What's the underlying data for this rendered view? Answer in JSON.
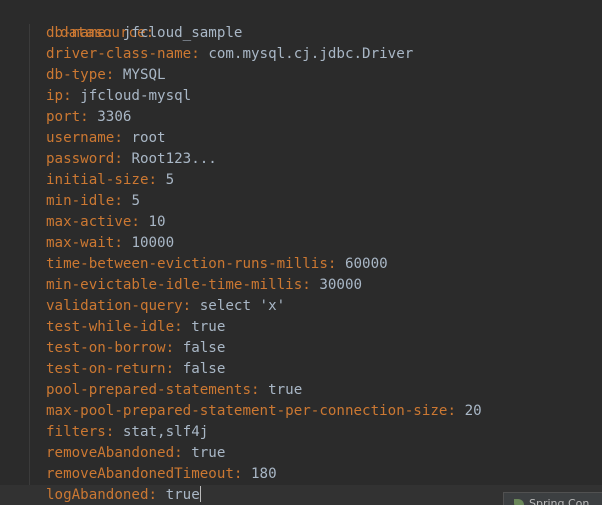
{
  "colors": {
    "background": "#2b2b2b",
    "key": "#cc7832",
    "value": "#a9b7c6"
  },
  "yaml": {
    "root_key": "datasource",
    "entries": [
      {
        "key": "db-name",
        "value": "jfcloud_sample"
      },
      {
        "key": "driver-class-name",
        "value": "com.mysql.cj.jdbc.Driver"
      },
      {
        "key": "db-type",
        "value": "MYSQL"
      },
      {
        "key": "ip",
        "value": "jfcloud-mysql"
      },
      {
        "key": "port",
        "value": "3306"
      },
      {
        "key": "username",
        "value": "root"
      },
      {
        "key": "password",
        "value": "Root123..."
      },
      {
        "key": "initial-size",
        "value": "5"
      },
      {
        "key": "min-idle",
        "value": "5"
      },
      {
        "key": "max-active",
        "value": "10"
      },
      {
        "key": "max-wait",
        "value": "10000"
      },
      {
        "key": "time-between-eviction-runs-millis",
        "value": "60000"
      },
      {
        "key": "min-evictable-idle-time-millis",
        "value": "30000"
      },
      {
        "key": "validation-query",
        "value": "select 'x'"
      },
      {
        "key": "test-while-idle",
        "value": "true"
      },
      {
        "key": "test-on-borrow",
        "value": "false"
      },
      {
        "key": "test-on-return",
        "value": "false"
      },
      {
        "key": "pool-prepared-statements",
        "value": "true"
      },
      {
        "key": "max-pool-prepared-statement-per-connection-size",
        "value": "20"
      },
      {
        "key": "filters",
        "value": "stat,slf4j"
      },
      {
        "key": "removeAbandoned",
        "value": "true"
      },
      {
        "key": "removeAbandonedTimeout",
        "value": "180"
      },
      {
        "key": "logAbandoned",
        "value": "true"
      }
    ]
  },
  "popup": {
    "label": "Spring Con",
    "icon": "spring-leaf-icon"
  }
}
